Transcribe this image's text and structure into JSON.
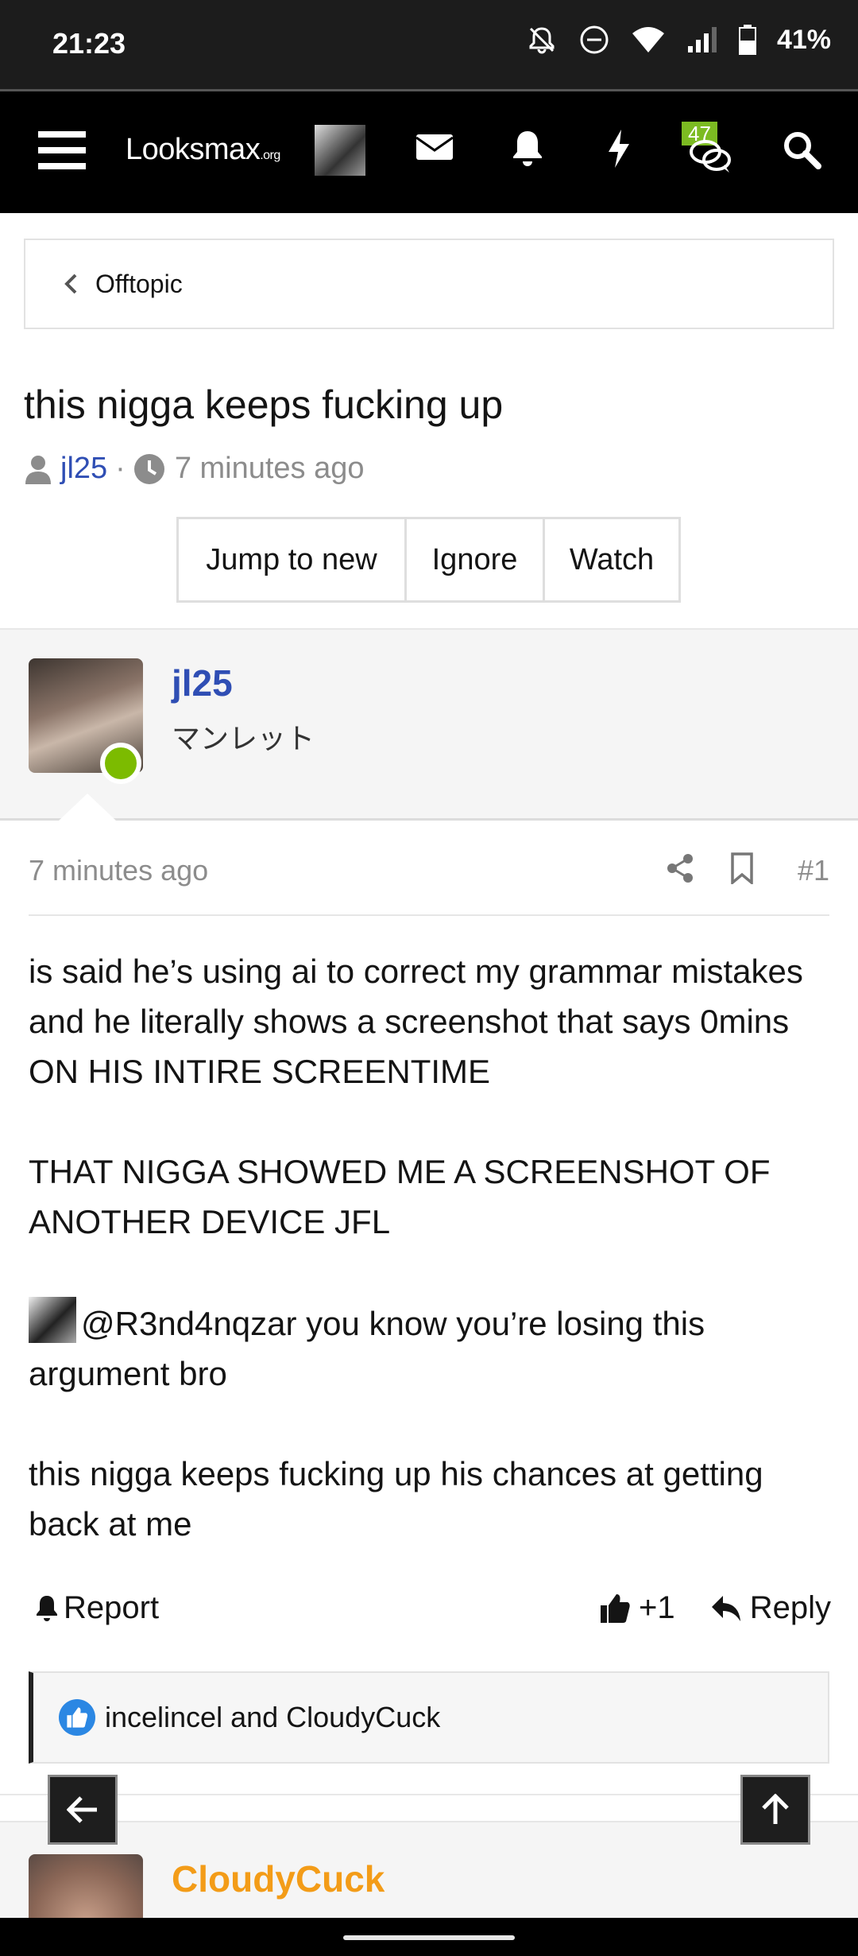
{
  "status_bar": {
    "time": "21:23",
    "battery": "41%"
  },
  "header": {
    "logo_main": "Looksmax",
    "logo_suffix": ".org",
    "conversations_badge": "47"
  },
  "breadcrumb": {
    "label": "Offtopic"
  },
  "thread": {
    "title": "this nigga keeps fucking up",
    "author": "jl25",
    "separator": "·",
    "time_ago": "7 minutes ago"
  },
  "buttons": {
    "jump": "Jump to new",
    "ignore": "Ignore",
    "watch": "Watch"
  },
  "post": {
    "username": "jl25",
    "user_title": "マンレット",
    "time_ago": "7 minutes ago",
    "number": "#1",
    "paragraph1": "is said he’s using ai to correct my grammar mistakes and he literally shows a screenshot that says 0mins ON HIS INTIRE SCREENTIME",
    "paragraph2": "THAT NIGGA SHOWED ME A SCREENSHOT OF ANOTHER DEVICE JFL",
    "mention": "@R3nd4nqzar",
    "paragraph3_rest": " you know you’re losing this argument bro",
    "paragraph4": "this nigga keeps fucking up his chances at getting back at me",
    "report_label": "Report",
    "like_label": "+1",
    "reply_label": "Reply",
    "reactions_text": "incelincel and CloudyCuck"
  },
  "next_post": {
    "username": "CloudyCuck"
  },
  "colors": {
    "link_blue": "#2f4eb4",
    "online_green": "#7cbb00",
    "next_user_orange": "#f39c18",
    "badge_green": "#7cbb22"
  }
}
